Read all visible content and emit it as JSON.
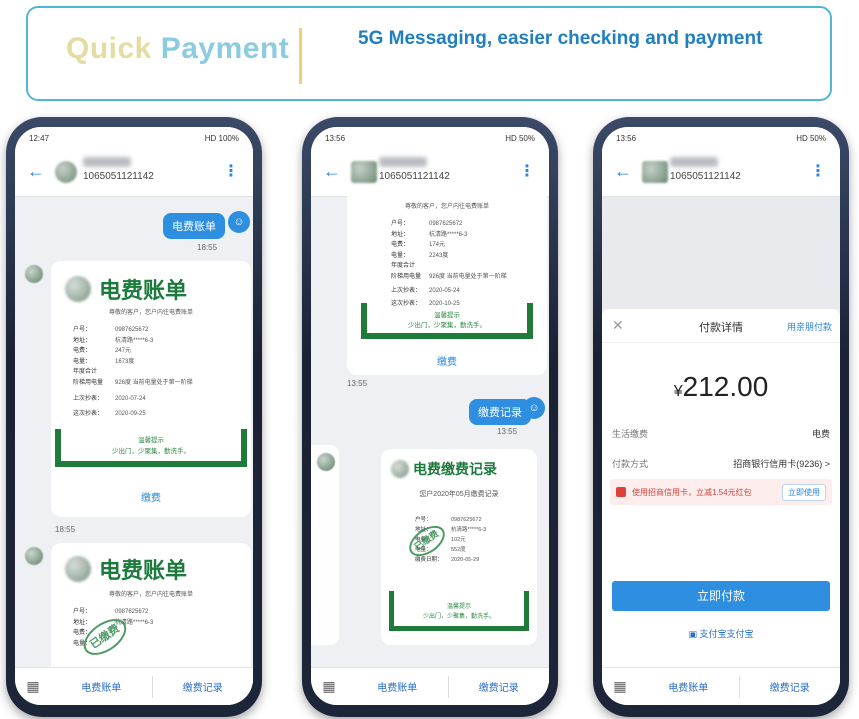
{
  "banner": {
    "brand_part1": "Quick",
    "brand_part2": " Payment",
    "tagline": "5G Messaging,  easier checking and payment",
    "colors": {
      "border": "#4fb6d6",
      "brand1": "#e3dca3",
      "brand2": "#8ccbe0",
      "tagline": "#1f7fbf"
    }
  },
  "phone1": {
    "status_time": "12:47",
    "status_right": "HD 100%",
    "number": "1065051121142",
    "sent_message": "电费账单",
    "sent_time": "18:55",
    "card_title": "电费账单",
    "card_subtitle": "尊敬的客户，您户内往电费账单",
    "rows": [
      {
        "k": "户号：",
        "v": "0987625672"
      },
      {
        "k": "地址：",
        "v": "杭清路*****6-3"
      },
      {
        "k": "电费：",
        "v": "247元"
      },
      {
        "k": "电量：",
        "v": "1673度"
      },
      {
        "k": "年度合计",
        "v": ""
      },
      {
        "k": "阶梯用电量",
        "v": "926度 当前电量处于第一阶梯"
      },
      {
        "k": "上次抄表：",
        "v": "2020-07-24"
      },
      {
        "k": "这次抄表：",
        "v": "2020-09-25"
      }
    ],
    "note_line1": "温馨提示",
    "note_line2": "少出门，少聚集，勤洗手。",
    "card_link": "缴费",
    "time2": "18:55",
    "card2_title": "电费账单",
    "card2_subtitle": "尊敬的客户，您户内往电费账单",
    "card2_rows": [
      {
        "k": "户号：",
        "v": "0987625672"
      },
      {
        "k": "地址：",
        "v": "杭清路*****6-3"
      },
      {
        "k": "电费：",
        "v": ""
      },
      {
        "k": "电量：",
        "v": ""
      }
    ],
    "stamp_text": "已缴费",
    "bottom_left": "电费账单",
    "bottom_right": "缴费记录"
  },
  "phone2": {
    "status_time": "13:56",
    "status_right": "HD 50%",
    "number": "1065051121142",
    "card_subtitle": "尊敬的客户，您户内往电费账单",
    "rows": [
      {
        "k": "户号：",
        "v": "0987625672"
      },
      {
        "k": "地址：",
        "v": "杭清路*****6-3"
      },
      {
        "k": "电费：",
        "v": "174元"
      },
      {
        "k": "电量：",
        "v": "2243度"
      },
      {
        "k": "年度合计",
        "v": ""
      },
      {
        "k": "阶梯用电量",
        "v": "926度 当前电量处于第一阶梯"
      },
      {
        "k": "上次抄表：",
        "v": "2020-05-24"
      },
      {
        "k": "这次抄表：",
        "v": "2020-10-25"
      }
    ],
    "note_line1": "温馨提示",
    "note_line2": "少出门，少聚集，勤洗手。",
    "card_link": "缴费",
    "time1": "13:55",
    "sent_message": "缴费记录",
    "sent_time": "13:55",
    "card2_title": "电费缴费记录",
    "card2_subtitle": "您户2020年05月缴费记录",
    "card2_rows": [
      {
        "k": "户号：",
        "v": "0987625672"
      },
      {
        "k": "地址：",
        "v": "杭清路*****6-3"
      },
      {
        "k": "电费：",
        "v": "102元"
      },
      {
        "k": "电量：",
        "v": "552度"
      },
      {
        "k": "缴费日期：",
        "v": "2020-05-29"
      }
    ],
    "stamp_text": "已缴费",
    "note2_line1": "温馨提示",
    "note2_line2": "少出门，少聚集，勤洗手。",
    "bottom_left": "电费账单",
    "bottom_right": "缴费记录"
  },
  "phone3": {
    "status_time": "13:56",
    "status_right": "HD 50%",
    "number": "1065051121142",
    "sheet_title": "付款详情",
    "sheet_link": "用亲朋付款",
    "currency": "¥",
    "amount": "212.00",
    "row1_label": "生活缴费",
    "row1_value": "电费",
    "row2_label": "付款方式",
    "row2_value": "招商银行信用卡(9236) >",
    "promo_text": "使用招商信用卡，立减1.54元红包",
    "promo_button": "立即使用",
    "pay_button": "立即付款",
    "alipay_link": "支付宝支付宝",
    "bottom_left": "电费账单",
    "bottom_right": "缴费记录"
  }
}
